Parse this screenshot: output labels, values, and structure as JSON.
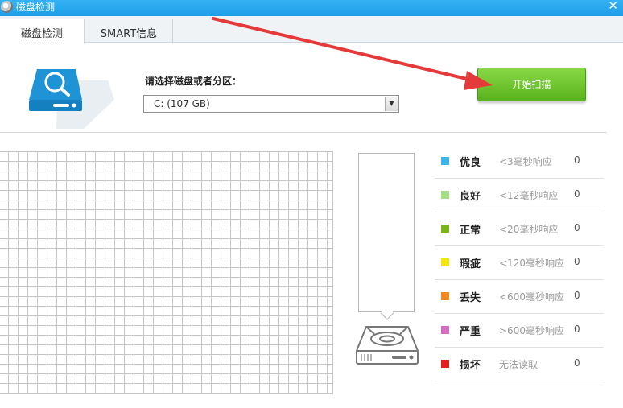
{
  "window": {
    "title": "磁盘检测",
    "icon": "app-logo-icon",
    "close_label": "✕"
  },
  "tabs": [
    {
      "label": "磁盘检测",
      "active": true
    },
    {
      "label": "SMART信息",
      "active": false
    }
  ],
  "disk_select": {
    "label": "请选择磁盘或者分区：",
    "value": "C:  (107 GB)"
  },
  "scan_button": {
    "label": "开始扫描"
  },
  "legend": [
    {
      "label": "优良",
      "range": "<3毫秒响应",
      "count": "0",
      "color": "#3bb3ee"
    },
    {
      "label": "良好",
      "range": "<12毫秒响应",
      "count": "0",
      "color": "#a4dd84"
    },
    {
      "label": "正常",
      "range": "<20毫秒响应",
      "count": "0",
      "color": "#7ab517"
    },
    {
      "label": "瑕疵",
      "range": "<120毫秒响应",
      "count": "0",
      "color": "#f1e90c"
    },
    {
      "label": "丢失",
      "range": "<600毫秒响应",
      "count": "0",
      "color": "#f08b1f"
    },
    {
      "label": "严重",
      "range": ">600毫秒响应",
      "count": "0",
      "color": "#cf6ec4"
    },
    {
      "label": "损坏",
      "range": "无法读取",
      "count": "0",
      "color": "#e41d1d"
    }
  ],
  "colors": {
    "titlebar": "#1e9ee9",
    "scan_button": "#6cc42a",
    "annotation_arrow": "#e53a3a",
    "disk_illustration": "#1e94d6"
  }
}
